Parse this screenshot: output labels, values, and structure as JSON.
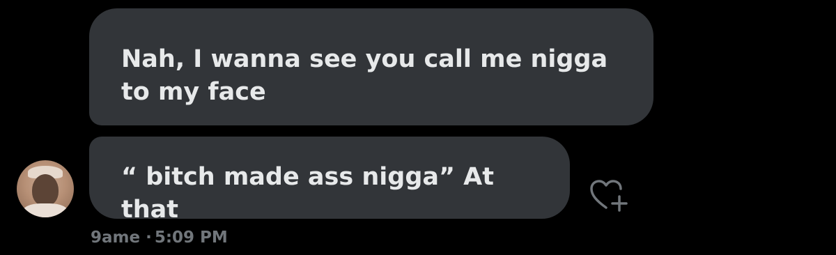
{
  "messages": [
    {
      "text": "Nah, I wanna see you call me nigga to my face"
    },
    {
      "text": "“ bitch made ass nigga” At that"
    }
  ],
  "meta": {
    "sender": "9ame",
    "separator": "·",
    "time": "5:09 PM"
  },
  "icons": {
    "reaction": "heart-plus-icon",
    "avatar": "avatar"
  },
  "colors": {
    "background": "#000000",
    "bubble": "#323539",
    "text": "#e7e9ea",
    "meta": "#71767b"
  }
}
